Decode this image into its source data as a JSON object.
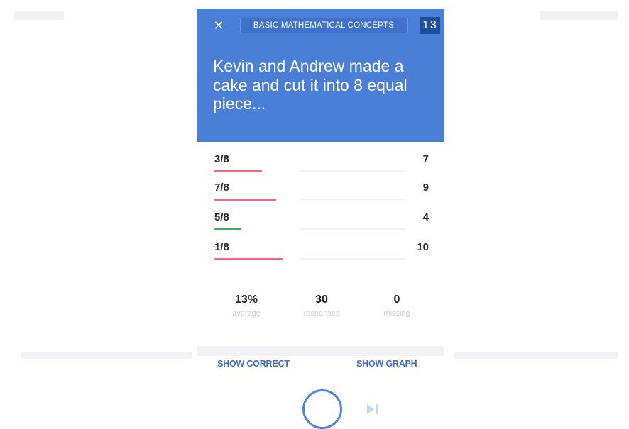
{
  "header": {
    "close_label": "✕",
    "category": "BASIC MATHEMATICAL CONCEPTS",
    "question_count": "13",
    "question_text": "Kevin and Andrew made a cake and cut it into 8 equal piece..."
  },
  "answers": [
    {
      "label": "3/8",
      "count": "7",
      "status": "wrong",
      "share": 0.23
    },
    {
      "label": "7/8",
      "count": "9",
      "status": "wrong",
      "share": 0.3
    },
    {
      "label": "5/8",
      "count": "4",
      "status": "correct",
      "share": 0.13
    },
    {
      "label": "1/8",
      "count": "10",
      "status": "wrong",
      "share": 0.33
    }
  ],
  "stats": {
    "average": {
      "value": "13%",
      "caption": "average"
    },
    "responses": {
      "value": "30",
      "caption": "responses"
    },
    "missing": {
      "value": "0",
      "caption": "missing"
    }
  },
  "actions": {
    "show_correct": "SHOW CORRECT",
    "show_graph": "SHOW GRAPH"
  },
  "colors": {
    "header_bg": "#4a7fd8",
    "wrong_bar": "#f06b7d",
    "correct_bar": "#3fae5c",
    "accent": "#3d6dcc"
  },
  "icons": {
    "close": "close-icon",
    "record": "record-circle-icon",
    "skip": "skip-next-icon"
  }
}
